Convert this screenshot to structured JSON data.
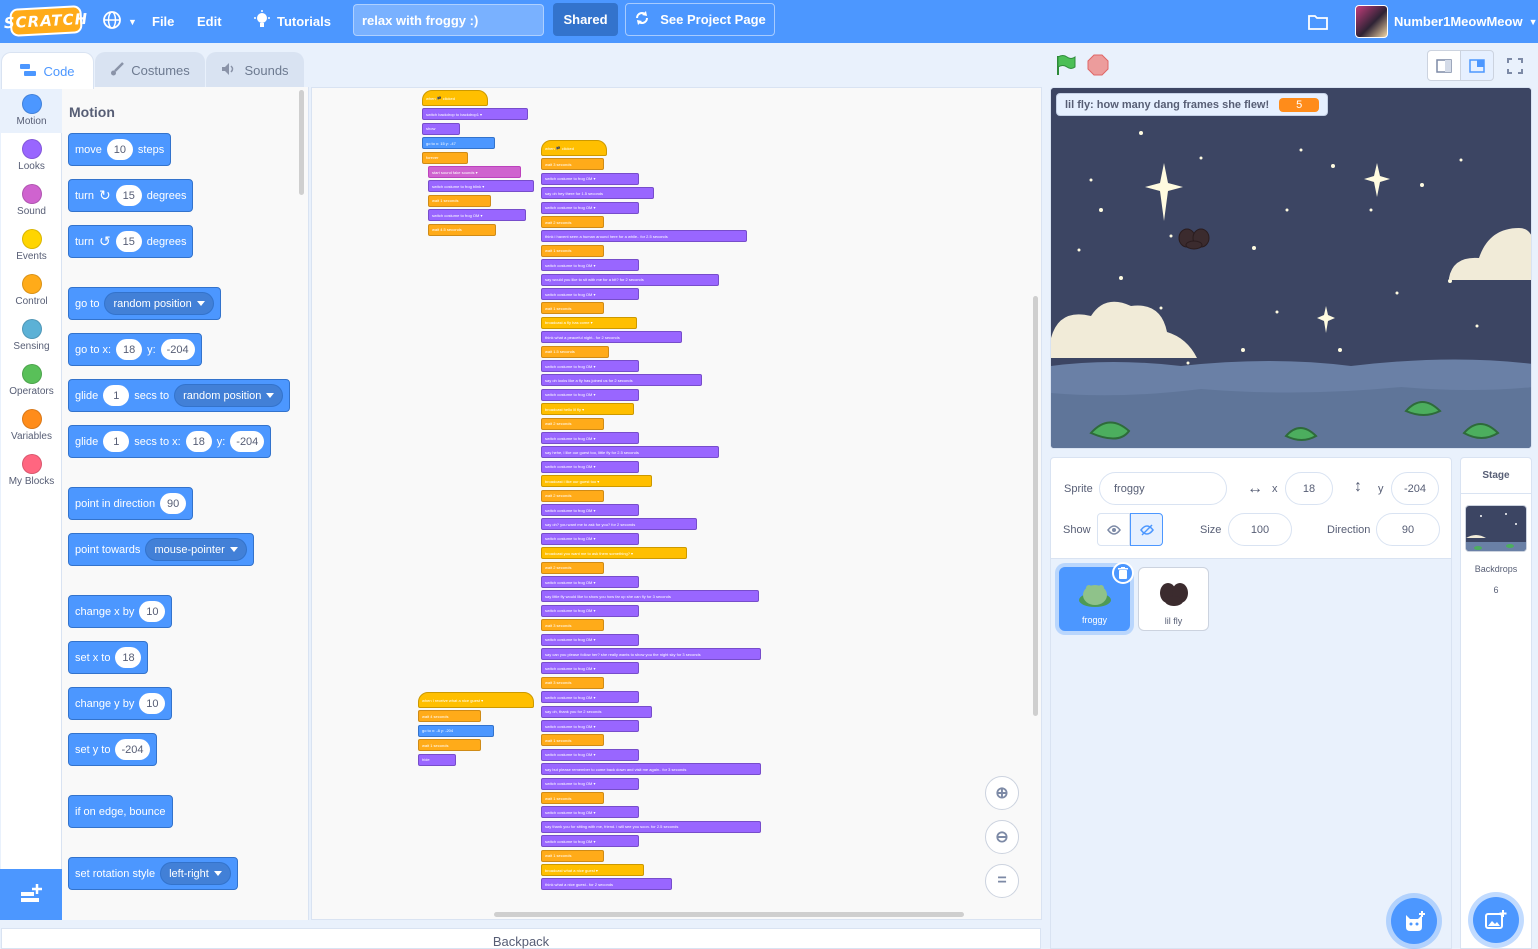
{
  "menubar": {
    "logo": "SCRATCH",
    "file": "File",
    "edit": "Edit",
    "tutorials": "Tutorials",
    "project_title": "relax with froggy :)",
    "shared": "Shared",
    "see_project": "See Project Page",
    "username": "Number1MeowMeow"
  },
  "tabs": {
    "code": "Code",
    "costumes": "Costumes",
    "sounds": "Sounds"
  },
  "categories": [
    {
      "label": "Motion",
      "color": "#4c97ff"
    },
    {
      "label": "Looks",
      "color": "#9966ff"
    },
    {
      "label": "Sound",
      "color": "#cf63cf"
    },
    {
      "label": "Events",
      "color": "#ffd500"
    },
    {
      "label": "Control",
      "color": "#ffab19"
    },
    {
      "label": "Sensing",
      "color": "#5cb1d6"
    },
    {
      "label": "Operators",
      "color": "#59c059"
    },
    {
      "label": "Variables",
      "color": "#ff8c1a"
    },
    {
      "label": "My Blocks",
      "color": "#ff6680"
    }
  ],
  "flyout": {
    "heading": "Motion",
    "move": {
      "a": "move",
      "v": "10",
      "b": "steps"
    },
    "turn_right": {
      "a": "turn",
      "v": "15",
      "b": "degrees"
    },
    "turn_left": {
      "a": "turn",
      "v": "15",
      "b": "degrees"
    },
    "goto": {
      "a": "go to",
      "d": "random position"
    },
    "gotoxy": {
      "a": "go to x:",
      "x": "18",
      "y_label": "y:",
      "y": "-204"
    },
    "glide": {
      "a": "glide",
      "v": "1",
      "b": "secs to",
      "d": "random position"
    },
    "glidexy": {
      "a": "glide",
      "v": "1",
      "b": "secs to x:",
      "x": "18",
      "y_label": "y:",
      "y": "-204"
    },
    "point_dir": {
      "a": "point in direction",
      "v": "90"
    },
    "point_towards": {
      "a": "point towards",
      "d": "mouse-pointer"
    },
    "change_x": {
      "a": "change x by",
      "v": "10"
    },
    "set_x": {
      "a": "set x to",
      "v": "18"
    },
    "change_y": {
      "a": "change y by",
      "v": "10"
    },
    "set_y": {
      "a": "set y to",
      "v": "-204"
    },
    "bounce": {
      "a": "if on edge, bounce"
    },
    "rotation": {
      "a": "set rotation style",
      "d": "left-right"
    }
  },
  "scripts": {
    "script1": [
      {
        "c": "ev",
        "t": "when 🏴 clicked",
        "hat": true
      },
      {
        "c": "lk",
        "t": "switch backdrop to  backdrop1 ▾"
      },
      {
        "c": "lk",
        "t": "show"
      },
      {
        "c": "mo",
        "t": "go to x: 15 y: -47"
      },
      {
        "c": "ct",
        "t": "forever"
      },
      {
        "c": "so",
        "t": "start sound  fake sounds ▾",
        "indent": true
      },
      {
        "c": "lk",
        "t": "switch costume to  frog blink ▾",
        "indent": true
      },
      {
        "c": "ct",
        "t": "wait 1 seconds",
        "indent": true
      },
      {
        "c": "lk",
        "t": "switch costume to  frog OM ▾",
        "indent": true
      },
      {
        "c": "ct",
        "t": "wait 4.5 seconds",
        "indent": true
      }
    ],
    "script2": [
      {
        "c": "ev",
        "t": "when 🏴 clicked",
        "hat": true
      },
      {
        "c": "ct",
        "t": "wait 3 seconds"
      },
      {
        "c": "lk",
        "t": "switch costume to  frog OM ▾"
      },
      {
        "c": "lk",
        "t": "say  oh hey there  for 1.5 seconds"
      },
      {
        "c": "lk",
        "t": "switch costume to  frog OM ▾"
      },
      {
        "c": "ct",
        "t": "wait 2 seconds"
      },
      {
        "c": "lk",
        "t": "think  i havent seen a human around here for a while..  for 2.5 seconds"
      },
      {
        "c": "ct",
        "t": "wait 1 seconds"
      },
      {
        "c": "lk",
        "t": "switch costume to  frog OM ▾"
      },
      {
        "c": "lk",
        "t": "say  would you like to sit with me for a bit?  for 2 seconds"
      },
      {
        "c": "lk",
        "t": "switch costume to  frog OM ▾"
      },
      {
        "c": "ct",
        "t": "wait 1 seconds"
      },
      {
        "c": "ev",
        "t": "broadcast  a fly has come ▾"
      },
      {
        "c": "lk",
        "t": "think  what a peaceful night..  for 2 seconds"
      },
      {
        "c": "ct",
        "t": "wait 1.5 seconds"
      },
      {
        "c": "lk",
        "t": "switch costume to  frog OM ▾"
      },
      {
        "c": "lk",
        "t": "say  oh looks like a fly has joined us  for 2 seconds"
      },
      {
        "c": "lk",
        "t": "switch costume to  frog OM ▾"
      },
      {
        "c": "ev",
        "t": "broadcast  hello lil fly ▾"
      },
      {
        "c": "ct",
        "t": "wait 2 seconds"
      },
      {
        "c": "lk",
        "t": "switch costume to  frog OM ▾"
      },
      {
        "c": "lk",
        "t": "say  hehe, i like our guest too, little fly  for 2.5 seconds"
      },
      {
        "c": "lk",
        "t": "switch costume to  frog OM ▾"
      },
      {
        "c": "ev",
        "t": "broadcast  i like our guest too ▾"
      },
      {
        "c": "ct",
        "t": "wait 2 seconds"
      },
      {
        "c": "lk",
        "t": "switch costume to  frog OM ▾"
      },
      {
        "c": "lk",
        "t": "say  oh? you want me to ask for you?  for 2 seconds"
      },
      {
        "c": "lk",
        "t": "switch costume to  frog OM ▾"
      },
      {
        "c": "ev",
        "t": "broadcast  you want me to ask them something? ▾"
      },
      {
        "c": "ct",
        "t": "wait 2 seconds"
      },
      {
        "c": "lk",
        "t": "switch costume to  frog OM ▾"
      },
      {
        "c": "lk",
        "t": "say  little fly would like to show you how far up she can fly  for 3 seconds"
      },
      {
        "c": "lk",
        "t": "switch costume to  frog OM ▾"
      },
      {
        "c": "ct",
        "t": "wait 3 seconds"
      },
      {
        "c": "lk",
        "t": "switch costume to  frog OM ▾"
      },
      {
        "c": "lk",
        "t": "say  can you please follow her? she really wants to show you the night sky  for 3 seconds"
      },
      {
        "c": "lk",
        "t": "switch costume to  frog OM ▾"
      },
      {
        "c": "ct",
        "t": "wait 3 seconds"
      },
      {
        "c": "lk",
        "t": "switch costume to  frog OM ▾"
      },
      {
        "c": "lk",
        "t": "say  oh, thank you  for 2 seconds"
      },
      {
        "c": "lk",
        "t": "switch costume to  frog OM ▾"
      },
      {
        "c": "ct",
        "t": "wait 1 seconds"
      },
      {
        "c": "lk",
        "t": "switch costume to  frog OM ▾"
      },
      {
        "c": "lk",
        "t": "say  but please remember to come back down and visit me again..  for 3 seconds"
      },
      {
        "c": "lk",
        "t": "switch costume to  frog OM ▾"
      },
      {
        "c": "ct",
        "t": "wait 1 seconds"
      },
      {
        "c": "lk",
        "t": "switch costume to  frog OM ▾"
      },
      {
        "c": "lk",
        "t": "say  thank you for sitting with me, friend. i will see you soon.  for 2.5 seconds"
      },
      {
        "c": "lk",
        "t": "switch costume to  frog OM ▾"
      },
      {
        "c": "ct",
        "t": "wait 1 seconds"
      },
      {
        "c": "ev",
        "t": "broadcast  what a nice guest ▾"
      },
      {
        "c": "lk",
        "t": "think  what a nice guest..  for 2 seconds"
      }
    ],
    "script3": [
      {
        "c": "ev",
        "t": "when I receive  what a nice guest ▾",
        "hat": true
      },
      {
        "c": "ct",
        "t": "wait 4 seconds"
      },
      {
        "c": "mo",
        "t": "go to x: -8 y: -204"
      },
      {
        "c": "ct",
        "t": "wait 1 seconds"
      },
      {
        "c": "lk",
        "t": "hide"
      }
    ]
  },
  "backpack": "Backpack",
  "stage": {
    "monitor_label": "lil fly: how many dang frames she flew!",
    "monitor_value": "5"
  },
  "sprite_info": {
    "sprite_label": "Sprite",
    "sprite_name": "froggy",
    "x_label": "x",
    "x": "18",
    "y_label": "y",
    "y": "-204",
    "show_label": "Show",
    "size_label": "Size",
    "size": "100",
    "direction_label": "Direction",
    "direction": "90"
  },
  "sprites": [
    {
      "name": "froggy",
      "selected": true
    },
    {
      "name": "lil fly",
      "selected": false
    }
  ],
  "stage_panel": {
    "title": "Stage",
    "backdrops_label": "Backdrops",
    "backdrops_count": "6"
  },
  "colors": {
    "menubar": "#4c97ff",
    "motion": "#4c97ff",
    "looks": "#9966ff",
    "events": "#ffbf00",
    "control": "#ffab19",
    "monitor_value": "#ff8c1a"
  }
}
